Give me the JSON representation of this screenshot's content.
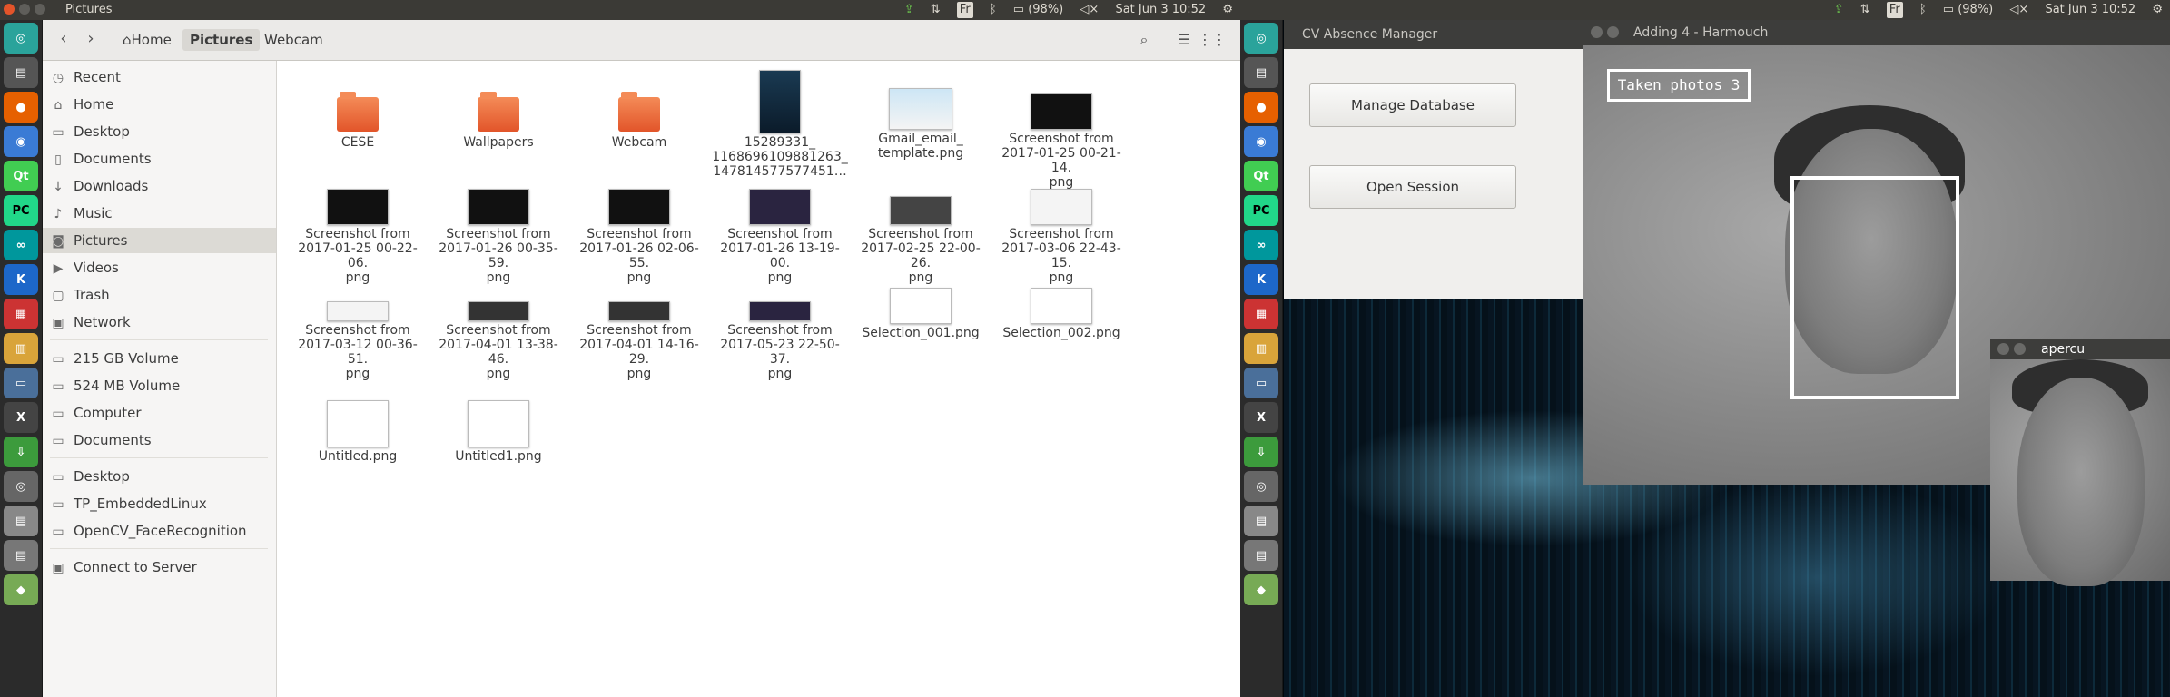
{
  "left_screen": {
    "panel_title": "Pictures",
    "tray": {
      "lang": "Fr",
      "battery": "(98%)",
      "clock": "Sat Jun  3 10:52"
    },
    "breadcrumbs": [
      "Home",
      "Pictures",
      "Webcam"
    ],
    "sidebar": {
      "places": [
        "Recent",
        "Home",
        "Desktop",
        "Documents",
        "Downloads",
        "Music",
        "Pictures",
        "Videos",
        "Trash",
        "Network"
      ],
      "devices": [
        "215 GB Volume",
        "524 MB Volume",
        "Computer",
        "Documents"
      ],
      "bookmarks": [
        "Desktop",
        "TP_EmbeddedLinux",
        "OpenCV_FaceRecognition"
      ],
      "connect": "Connect to Server"
    },
    "files": [
      {
        "l1": "CESE",
        "l2": "",
        "l3": ""
      },
      {
        "l1": "Wallpapers",
        "l2": "",
        "l3": ""
      },
      {
        "l1": "Webcam",
        "l2": "",
        "l3": ""
      },
      {
        "l1": "15289331_",
        "l2": "1168696109881263_",
        "l3": "147814577577451…"
      },
      {
        "l1": "Gmail_email_",
        "l2": "template.png",
        "l3": ""
      },
      {
        "l1": "Screenshot from",
        "l2": "2017-01-25 00-21-14.",
        "l3": "png"
      },
      {
        "l1": "Screenshot from",
        "l2": "2017-01-25 00-22-06.",
        "l3": "png"
      },
      {
        "l1": "Screenshot from",
        "l2": "2017-01-26 00-35-59.",
        "l3": "png"
      },
      {
        "l1": "Screenshot from",
        "l2": "2017-01-26 02-06-55.",
        "l3": "png"
      },
      {
        "l1": "Screenshot from",
        "l2": "2017-01-26 13-19-00.",
        "l3": "png"
      },
      {
        "l1": "Screenshot from",
        "l2": "2017-02-25 22-00-26.",
        "l3": "png"
      },
      {
        "l1": "Screenshot from",
        "l2": "2017-03-06 22-43-15.",
        "l3": "png"
      },
      {
        "l1": "Screenshot from",
        "l2": "2017-03-12 00-36-51.",
        "l3": "png"
      },
      {
        "l1": "Screenshot from",
        "l2": "2017-04-01 13-38-46.",
        "l3": "png"
      },
      {
        "l1": "Screenshot from",
        "l2": "2017-04-01 14-16-29.",
        "l3": "png"
      },
      {
        "l1": "Screenshot from",
        "l2": "2017-05-23 22-50-37.",
        "l3": "png"
      },
      {
        "l1": "Selection_001.png",
        "l2": "",
        "l3": ""
      },
      {
        "l1": "Selection_002.png",
        "l2": "",
        "l3": ""
      },
      {
        "l1": "Untitled.png",
        "l2": "",
        "l3": ""
      },
      {
        "l1": "Untitled1.png",
        "l2": "",
        "l3": ""
      }
    ]
  },
  "right_screen": {
    "tray": {
      "lang": "Fr",
      "battery": "(98%)",
      "clock": "Sat Jun  3 10:52"
    },
    "cv_window": {
      "title": "CV Absence Manager",
      "manage_button": "Manage Database",
      "open_button": "Open Session"
    },
    "adding_window": {
      "title": "Adding 4 - Harmouch",
      "taken_label": "Taken photos  3"
    },
    "apercu_window": {
      "title": "apercu"
    }
  },
  "colors": {
    "accent": "#e2552a",
    "panel": "#3b3a36",
    "launcher": "#2b2b2b",
    "selection": "#dcdad5"
  }
}
